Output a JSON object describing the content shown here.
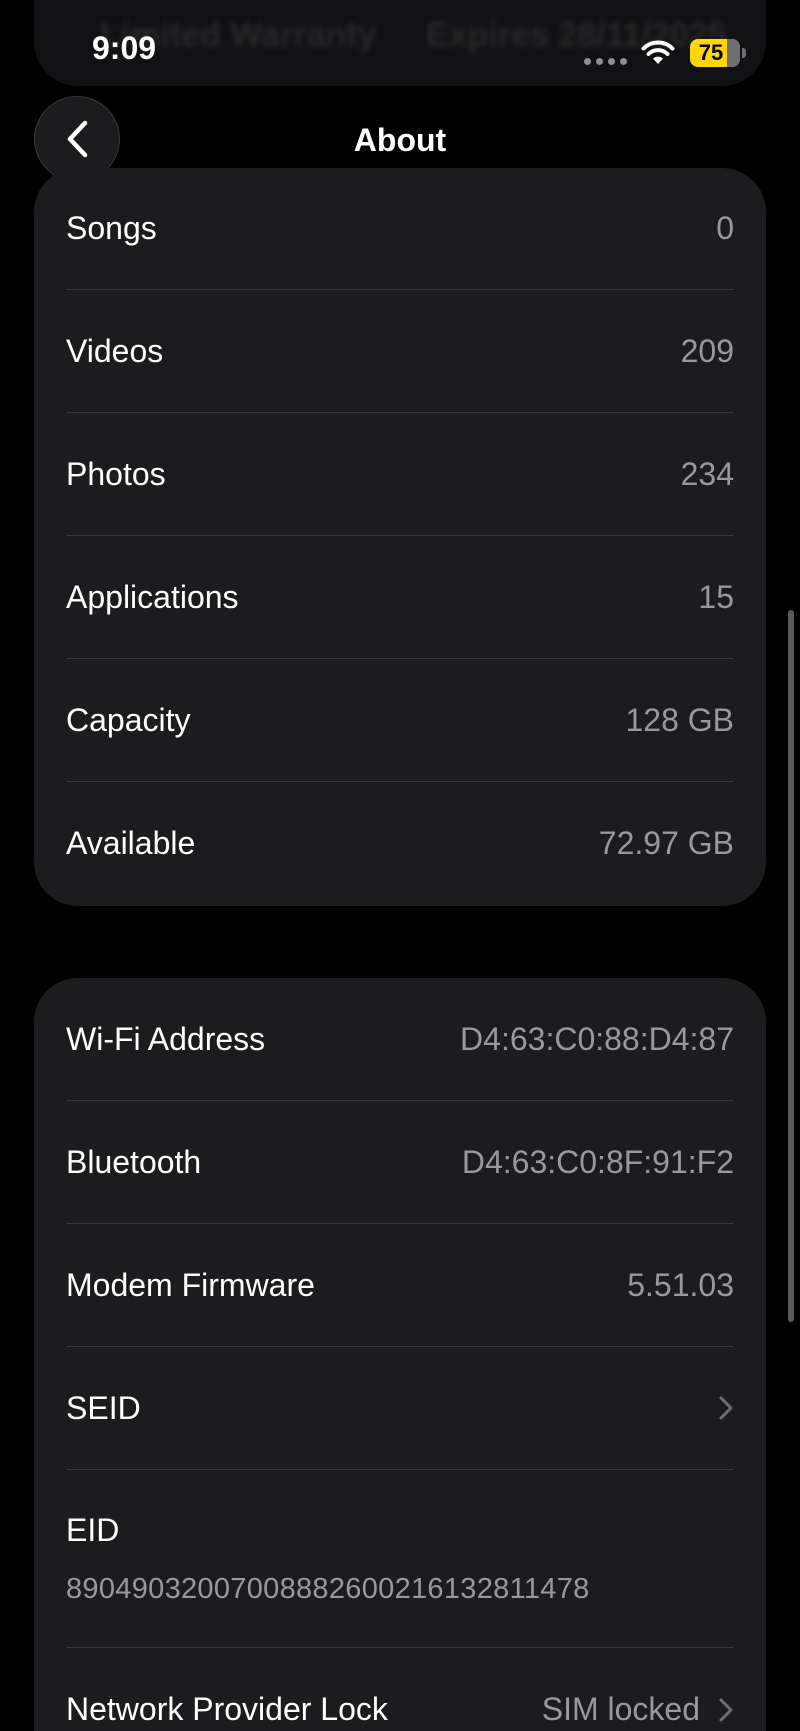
{
  "status_bar": {
    "time": "9:09",
    "battery_level": "75",
    "battery_fraction": 0.75,
    "battery_color": "#ffd60a"
  },
  "background_ghost": {
    "left_text": "Limited Warranty",
    "right_text": "Expires 28/11/2025"
  },
  "nav": {
    "title": "About",
    "back_icon": "chevron-left-icon"
  },
  "media_section": {
    "rows": [
      {
        "label": "Songs",
        "value": "0"
      },
      {
        "label": "Videos",
        "value": "209"
      },
      {
        "label": "Photos",
        "value": "234"
      },
      {
        "label": "Applications",
        "value": "15"
      },
      {
        "label": "Capacity",
        "value": "128 GB"
      },
      {
        "label": "Available",
        "value": "72.97 GB"
      }
    ]
  },
  "network_section": {
    "rows": [
      {
        "label": "Wi-Fi Address",
        "value": "D4:63:C0:88:D4:87"
      },
      {
        "label": "Bluetooth",
        "value": "D4:63:C0:8F:91:F2"
      },
      {
        "label": "Modem Firmware",
        "value": "5.51.03"
      },
      {
        "label": "SEID",
        "value": ""
      },
      {
        "label": "EID",
        "value": "89049032007008882600216132811478"
      },
      {
        "label": "Network Provider Lock",
        "value": "SIM locked"
      }
    ]
  }
}
